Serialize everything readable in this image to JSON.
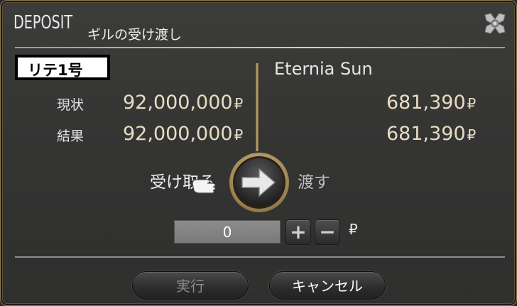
{
  "window": {
    "title": "DEPOSIT",
    "subtitle": "ギルの受け渡し",
    "close_icon": "gear-close-icon"
  },
  "trade": {
    "player_name": "リテ1号",
    "partner_name": "Eternia Sun",
    "rows": [
      {
        "label": "現状",
        "left_amount": "92,000,000",
        "right_amount": "681,390"
      },
      {
        "label": "結果",
        "left_amount": "92,000,000",
        "right_amount": "681,390"
      }
    ],
    "currency_symbol": "₽"
  },
  "direction": {
    "receive_label": "受け取る",
    "give_label": "渡す",
    "arrow_icon": "arrow-right-icon",
    "cursor_icon": "pointing-hand-icon"
  },
  "amount": {
    "value": "0",
    "plus_label": "+",
    "minus_label": "−",
    "currency_symbol": "₽"
  },
  "actions": {
    "execute_label": "実行",
    "cancel_label": "キャンセル"
  },
  "colors": {
    "frame_gold": "#8a7a55",
    "amount_text": "#e8dcc2",
    "disabled_text": "#8a8a8a"
  }
}
